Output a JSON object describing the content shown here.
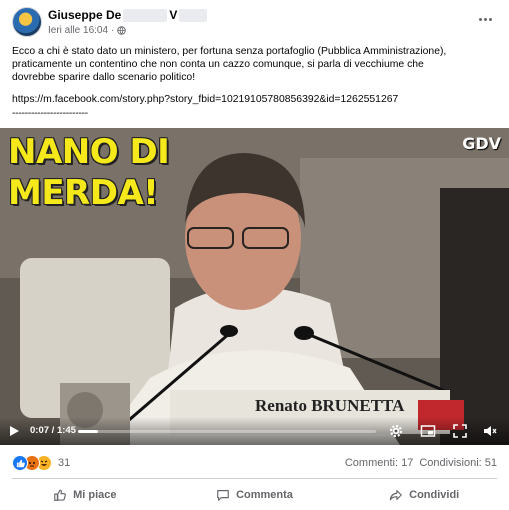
{
  "post": {
    "author_first": "Giuseppe De",
    "author_last": "V",
    "timestamp": "Ieri alle 16:04",
    "separator": "·",
    "text": "Ecco a chi è stato dato un ministero, per fortuna senza portafoglio (Pubblica Amministrazione),\npraticamente un contentino che non conta un cazzo comunque, si parla di vecchiume che\ndovrebbe sparire dallo scenario politico!",
    "link": "https://m.facebook.com/story.php?story_fbid=10219105780856392&id=1262551267",
    "dashes": "------------------------"
  },
  "video": {
    "overlay_title": "NANO DI\nMERDA!",
    "watermark": "GDV",
    "nameplate": "Renato BRUNETTA",
    "current_time": "0:07",
    "time_separator": " / ",
    "duration": "1:45",
    "progress_fraction": 0.067
  },
  "engagement": {
    "reaction_count": "31",
    "comments": "Commenti: 17",
    "shares": "Condivisioni: 51"
  },
  "actions": {
    "like": "Mi piace",
    "comment": "Commenta",
    "share": "Condividi"
  },
  "icons": {
    "more": "more-horizontal-icon",
    "privacy": "globe-icon",
    "play": "play-icon",
    "settings": "gear-icon",
    "fullscreen": "fullscreen-icon",
    "volume": "volume-icon"
  },
  "colors": {
    "facebook_blue": "#1877f2",
    "overlay_yellow": "#f5e91b",
    "secondary_text": "#65676b"
  }
}
